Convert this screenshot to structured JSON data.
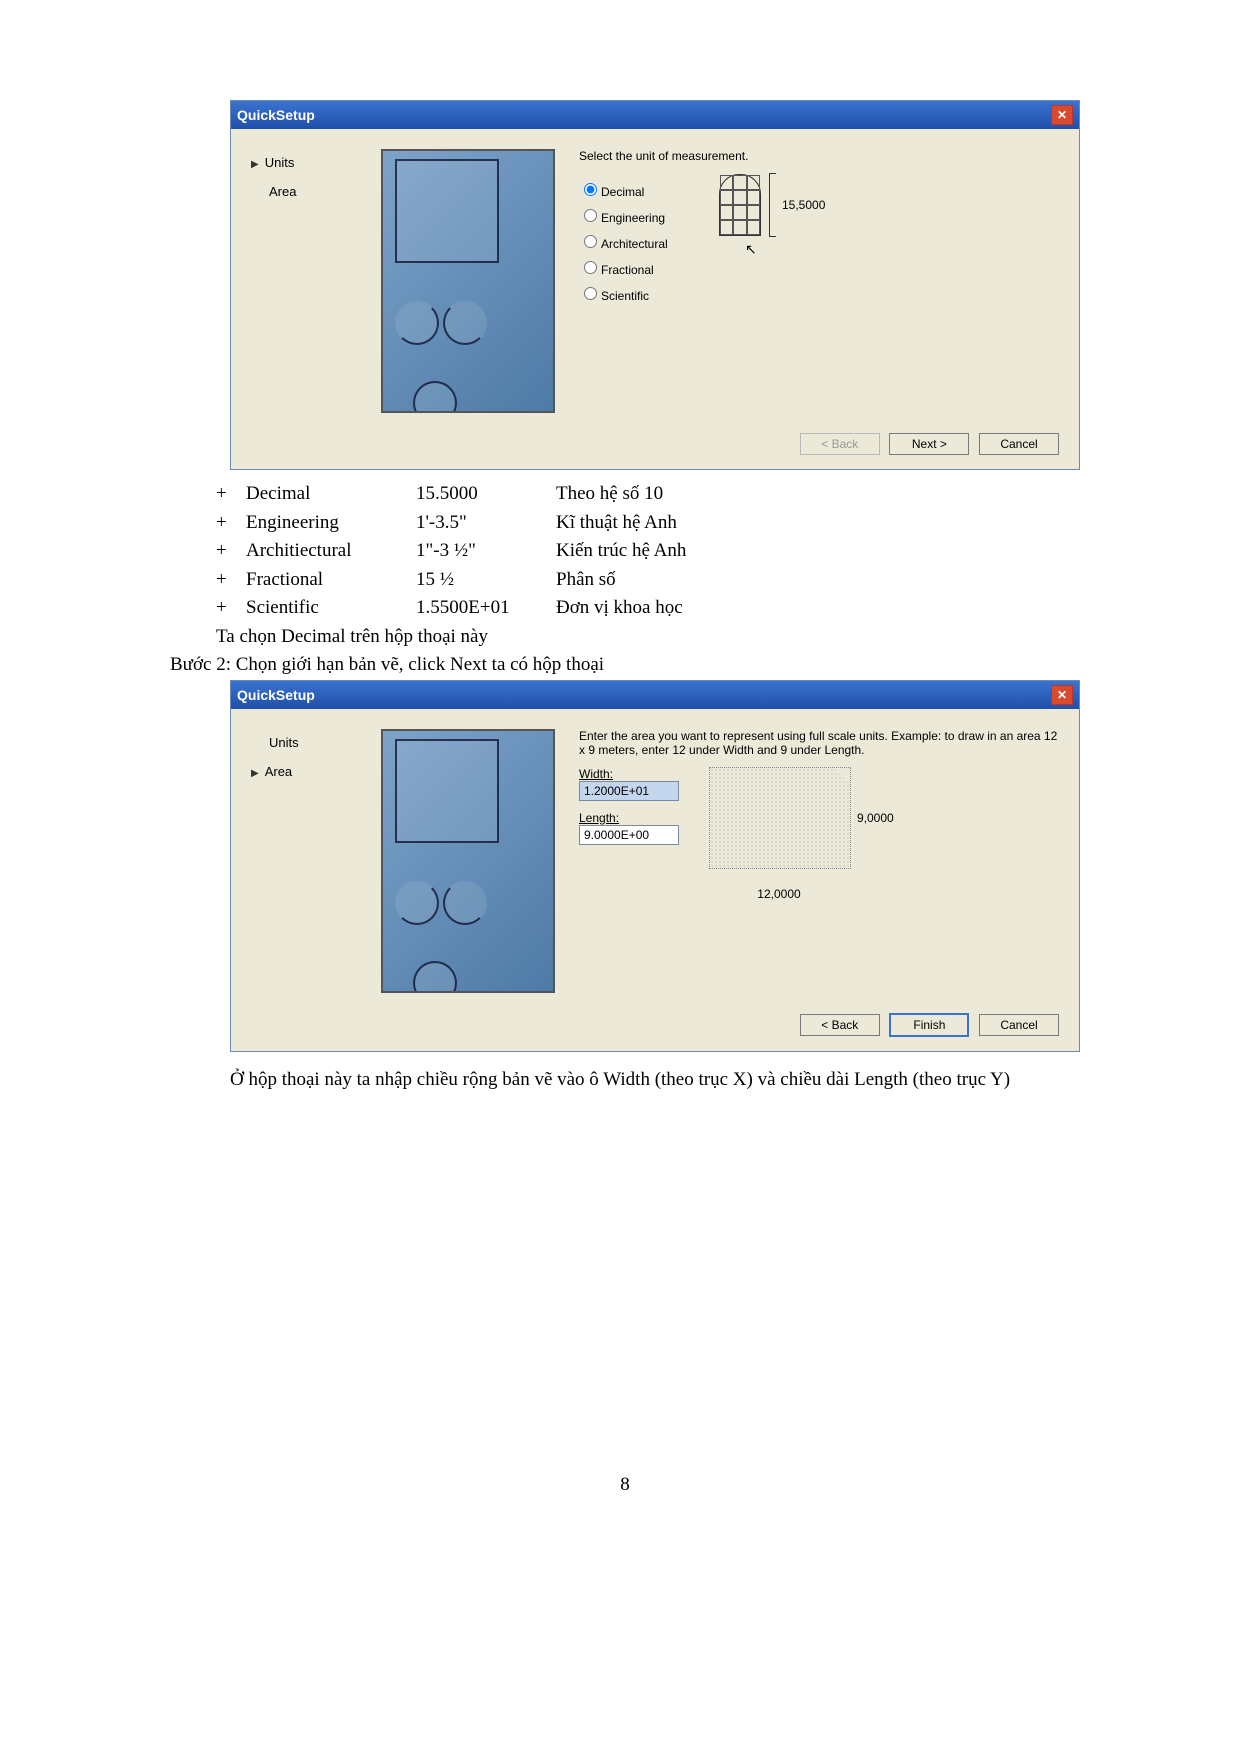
{
  "dialog1": {
    "title": "QuickSetup",
    "nav": {
      "units": "Units",
      "area": "Area"
    },
    "prompt": "Select the unit of measurement.",
    "options": {
      "decimal": "Decimal",
      "engineering": "Engineering",
      "architectural": "Architectural",
      "fractional": "Fractional",
      "scientific": "Scientific"
    },
    "sample_value": "15,5000",
    "back": "< Back",
    "next": "Next >",
    "cancel": "Cancel"
  },
  "unit_table": [
    {
      "plus": "+",
      "name": "Decimal",
      "example": "15.5000",
      "desc": "Theo hệ số 10"
    },
    {
      "plus": "+",
      "name": "Engineering",
      "example": "1'-3.5\"",
      "desc": "Kĩ thuật hệ Anh"
    },
    {
      "plus": "+",
      "name": "Architiectural",
      "example": "1\"-3 ½\"",
      "desc": "Kiến trúc hệ Anh"
    },
    {
      "plus": "+",
      "name": "Fractional",
      "example": "15 ½",
      "desc": "Phân số"
    },
    {
      "plus": "+",
      "name": "Scientific",
      "example": "1.5500E+01",
      "desc": "Đơn vị khoa học"
    }
  ],
  "text": {
    "line1": "Ta chọn Decimal trên hộp thoại này",
    "line2": "Bước 2: Chọn giới hạn bản vẽ, click Next ta có hộp thoại",
    "conclusion": "Ở hộp thoại này ta nhập chiều rộng bản vẽ vào ô Width (theo trục X) và chiều dài Length (theo trục Y)"
  },
  "dialog2": {
    "title": "QuickSetup",
    "nav": {
      "units": "Units",
      "area": "Area"
    },
    "prompt": "Enter the area you want to represent using full scale units.  Example: to draw in an area 12 x 9 meters, enter 12 under Width and 9 under Length.",
    "width_label": "Width:",
    "width_value": "1.2000E+01",
    "length_label": "Length:",
    "length_value": "9.0000E+00",
    "diagram_w": "12,0000",
    "diagram_h": "9,0000",
    "back": "< Back",
    "finish": "Finish",
    "cancel": "Cancel"
  },
  "page_number": "8"
}
